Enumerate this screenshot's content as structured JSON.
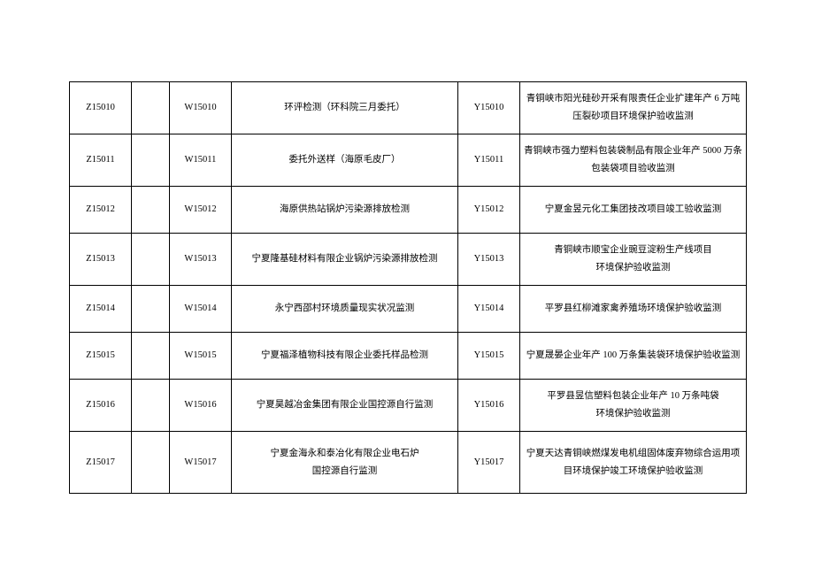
{
  "table": {
    "rows": [
      {
        "h": "h-md",
        "c0": "Z15010",
        "c1": "",
        "c2": "W15010",
        "c3": "环评检测（环科院三月委托）",
        "c4": "Y15010",
        "c5": "青铜峡市阳光硅砂开采有限责任企业扩建年产 6 万吨压裂砂项目环境保护验收监测"
      },
      {
        "h": "h-md",
        "c0": "Z15011",
        "c1": "",
        "c2": "W15011",
        "c3": "委托外送样（海原毛皮厂）",
        "c4": "Y15011",
        "c5": "青铜峡市强力塑料包装袋制品有限企业年产 5000 万条包装袋项目验收监测"
      },
      {
        "h": "h-sm",
        "c0": "Z15012",
        "c1": "",
        "c2": "W15012",
        "c3": "海原供热站锅炉污染源排放检测",
        "c4": "Y15012",
        "c5": "宁夏金昱元化工集团技改项目竣工验收监测"
      },
      {
        "h": "h-md",
        "c0": "Z15013",
        "c1": "",
        "c2": "W15013",
        "c3": "宁夏隆基硅材料有限企业锅炉污染源排放检测",
        "c4": "Y15013",
        "c5": "青铜峡市顺宝企业豌豆淀粉生产线项目\n环境保护验收监测"
      },
      {
        "h": "h-sm",
        "c0": "Z15014",
        "c1": "",
        "c2": "W15014",
        "c3": "永宁西邵村环境质量现实状况监测",
        "c4": "Y15014",
        "c5": "平罗县红柳滩家禽养殖场环境保护验收监测"
      },
      {
        "h": "h-sm",
        "c0": "Z15015",
        "c1": "",
        "c2": "W15015",
        "c3": "宁夏福泽植物科技有限企业委托样品检测",
        "c4": "Y15015",
        "c5": "宁夏晟晏企业年产 100 万条集装袋环境保护验收监测"
      },
      {
        "h": "h-md",
        "c0": "Z15016",
        "c1": "",
        "c2": "W15016",
        "c3": "宁夏昊越冶金集团有限企业国控源自行监测",
        "c4": "Y15016",
        "c5": "平罗县昱信塑料包装企业年产 10 万条吨袋\n环境保护验收监测"
      },
      {
        "h": "h-lg",
        "c0": "Z15017",
        "c1": "",
        "c2": "W15017",
        "c3": "宁夏金海永和泰冶化有限企业电石炉\n国控源自行监测",
        "c4": "Y15017",
        "c5": "宁夏天达青铜峡燃煤发电机组固体废弃物综合运用项目环境保护竣工环境保护验收监测"
      }
    ]
  }
}
